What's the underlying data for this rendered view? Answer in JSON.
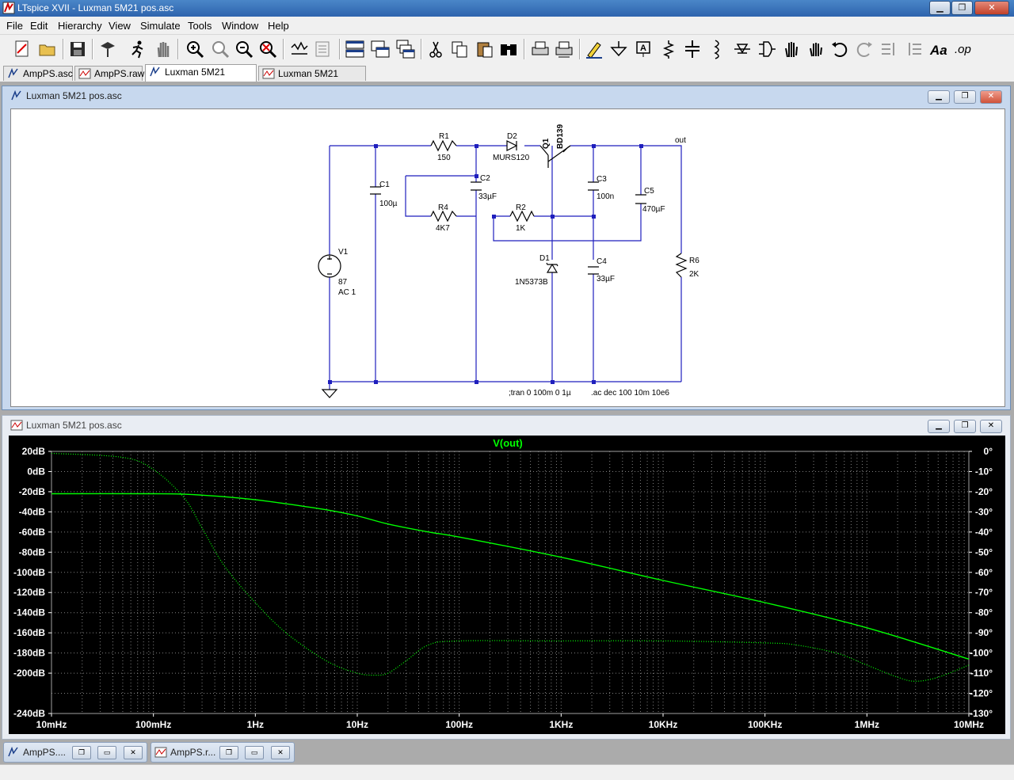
{
  "window": {
    "title": "LTspice XVII - Luxman 5M21 pos.asc",
    "buttons": {
      "minimize": "▁",
      "maximize": "❐",
      "close": "✕"
    }
  },
  "menu": [
    "File",
    "Edit",
    "Hierarchy",
    "View",
    "Simulate",
    "Tools",
    "Window",
    "Help"
  ],
  "toolbar": [
    "new-schematic",
    "open",
    "save",
    "control-panel",
    "run",
    "halt",
    "zoom-in",
    "zoom-pan",
    "zoom-out",
    "zoom-fit",
    "autorange",
    "mark-unref",
    "tile-horizontal",
    "tile-vertical",
    "cascade",
    "cut",
    "copy",
    "paste",
    "find",
    "print",
    "print-preview",
    "draw-wire",
    "ground",
    "label-net",
    "resistor",
    "capacitor",
    "inductor",
    "diode",
    "component",
    "move",
    "drag",
    "undo",
    "redo",
    "rotate",
    "mirror",
    "text",
    "spice-directive"
  ],
  "tabs": [
    {
      "label": "AmpPS.asc",
      "icon": "schematic-icon",
      "active": false
    },
    {
      "label": "AmpPS.raw",
      "icon": "waveform-icon",
      "active": false
    },
    {
      "label": "Luxman 5M21 pos.asc",
      "icon": "schematic-icon",
      "active": true
    },
    {
      "label": "Luxman 5M21 pos.asc",
      "icon": "waveform-icon",
      "active": false
    }
  ],
  "schematic": {
    "title": "Luxman 5M21 pos.asc",
    "components": {
      "r1": {
        "ref": "R1",
        "value": "150"
      },
      "d2": {
        "ref": "D2",
        "value": "MURS120"
      },
      "q1": {
        "ref": "Q1",
        "value": "BD139"
      },
      "c1": {
        "ref": "C1",
        "value": "100µ"
      },
      "c2": {
        "ref": "C2",
        "value": "33µF"
      },
      "c3": {
        "ref": "C3",
        "value": "100n"
      },
      "c5": {
        "ref": "C5",
        "value": "470µF"
      },
      "r4": {
        "ref": "R4",
        "value": "4K7"
      },
      "r2": {
        "ref": "R2",
        "value": "1K"
      },
      "v1": {
        "ref": "V1",
        "value": "87",
        "ac": "AC 1"
      },
      "d1": {
        "ref": "D1",
        "value": "1N5373B"
      },
      "c4": {
        "ref": "C4",
        "value": "33µF"
      },
      "r6": {
        "ref": "R6",
        "value": "2K"
      }
    },
    "net_out": "out",
    "directive_tran": ";tran 0 100m 0 1µ",
    "directive_ac": ".ac dec 100 10m 10e6"
  },
  "plot": {
    "title": "Luxman 5M21 pos.asc",
    "trace_name": "V(out)",
    "trace_color": "#00ff00",
    "grid_color": "#808080",
    "background": "#000000"
  },
  "chart_data": {
    "type": "line",
    "title": "V(out)",
    "x_scale": "log",
    "xlim": [
      0.01,
      10000000
    ],
    "x_tick_labels": [
      "10mHz",
      "100mHz",
      "1Hz",
      "10Hz",
      "100Hz",
      "1KHz",
      "10KHz",
      "100KHz",
      "1MHz",
      "10MHz"
    ],
    "ylim_left": [
      -240,
      20
    ],
    "y_tick_labels_left": [
      "20dB",
      "0dB",
      "-20dB",
      "-40dB",
      "-60dB",
      "-80dB",
      "-100dB",
      "-120dB",
      "-140dB",
      "-160dB",
      "-180dB",
      "-200dB",
      "-240dB"
    ],
    "y_ticks_left": [
      20,
      0,
      -20,
      -40,
      -60,
      -80,
      -100,
      -120,
      -140,
      -160,
      -180,
      -200,
      -220,
      -240
    ],
    "ylim_right": [
      -130,
      0
    ],
    "y_tick_labels_right": [
      "0°",
      "-10°",
      "-20°",
      "-30°",
      "-40°",
      "-50°",
      "-60°",
      "-70°",
      "-80°",
      "-90°",
      "-100°",
      "-110°",
      "-120°",
      "-130°"
    ],
    "series": [
      {
        "name": "V(out)",
        "axis": "left",
        "style": "solid",
        "x": [
          0.01,
          0.1,
          0.2,
          0.5,
          1,
          2,
          5,
          10,
          20,
          50,
          100,
          1000,
          10000,
          100000,
          1000000,
          10000000
        ],
        "y": [
          -22,
          -22,
          -22.5,
          -25,
          -28,
          -32,
          -38,
          -44,
          -52,
          -60,
          -65,
          -85,
          -108,
          -130,
          -155,
          -186
        ]
      },
      {
        "name": "V(out) phase",
        "axis": "right",
        "style": "dotted",
        "x": [
          0.01,
          0.05,
          0.1,
          0.2,
          0.3,
          0.5,
          1,
          2,
          5,
          10,
          15,
          20,
          30,
          50,
          100,
          1000,
          10000,
          100000,
          200000,
          500000,
          1000000,
          2000000,
          3000000,
          5000000,
          10000000
        ],
        "y": [
          -1,
          -3,
          -9,
          -23,
          -38,
          -57,
          -75,
          -90,
          -104,
          -110,
          -111,
          -110,
          -104,
          -96,
          -94,
          -94,
          -94,
          -95,
          -96,
          -100,
          -106,
          -112,
          -114,
          -112,
          -106
        ]
      }
    ]
  },
  "minimized": [
    {
      "label": "AmpPS....",
      "icon": "schematic-icon"
    },
    {
      "label": "AmpPS.r...",
      "icon": "waveform-icon"
    }
  ]
}
